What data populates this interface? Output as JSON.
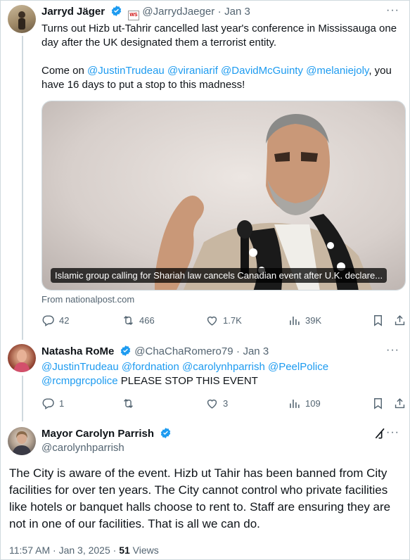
{
  "colors": {
    "accent": "#1d9bf0",
    "text": "#0f1419",
    "muted": "#536471",
    "border": "#cfd9de"
  },
  "tweet1": {
    "display_name": "Jarryd Jäger",
    "badge_label": "WS",
    "handle": "@JarrydJaeger",
    "separator": "·",
    "date": "Jan 3",
    "more_label": "···",
    "text_line1": "Turns out Hizb ut-Tahrir cancelled last year's conference in Mississauga one",
    "text_line2": "day after the UK designated them a terrorist entity.",
    "text_line3_prefix": "Come on ",
    "mentions": [
      "@JustinTrudeau",
      "@viraniarif",
      "@DavidMcGuinty",
      "@melaniejoly"
    ],
    "text_line3_suffix": ", you",
    "text_line4": "have 16 days to put a stop to this madness!",
    "link_card_caption": "Islamic group calling for Shariah law cancels Canadian event after U.K. declare...",
    "link_card_source": "From nationalpost.com",
    "stats": {
      "replies": "42",
      "reposts": "466",
      "likes": "1.7K",
      "views": "39K"
    }
  },
  "tweet2": {
    "display_name": "Natasha RoMe",
    "handle": "@ChaChaRomero79",
    "separator": "·",
    "date": "Jan 3",
    "more_label": "···",
    "mentions_line1": [
      "@JustinTrudeau",
      "@fordnation",
      "@carolynhparrish",
      "@PeelPolice"
    ],
    "mention_line2": "@rcmpgrcpolice",
    "text_line2_suffix": "PLEASE STOP THIS EVENT",
    "stats": {
      "replies": "1",
      "reposts": "",
      "likes": "3",
      "views": "109"
    }
  },
  "tweet3": {
    "display_name": "Mayor Carolyn Parrish",
    "handle": "@carolynhparrish",
    "more_label": "···",
    "text": "The City is aware of the event. Hizb ut Tahir has been banned from City facilities for over ten years. The City cannot control who private facilities like hotels or banquet halls choose to rent to. Staff are ensuring they are not in one of our facilities. That is all we can do.",
    "time": "11:57 AM",
    "separator": "·",
    "date": "Jan 3, 2025",
    "views_count": "51",
    "views_label": "Views"
  }
}
